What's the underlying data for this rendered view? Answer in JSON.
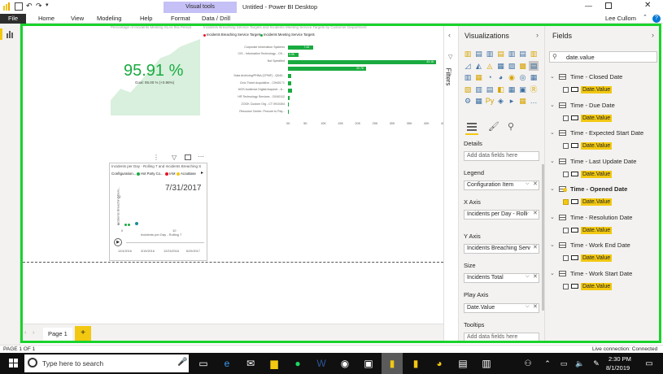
{
  "window": {
    "title": "Untitled - Power BI Desktop",
    "user": "Lee Cullom"
  },
  "ribbon": {
    "file": "File",
    "tabs": [
      "Home",
      "View",
      "Modeling",
      "Help",
      "Format",
      "Data / Drill"
    ],
    "contextual_group": "Visual tools"
  },
  "canvas": {
    "kpi_header": "Percentage of Incidents Meeting SLAs this Period",
    "kpi_value": "95.91 %",
    "kpi_goal": "Goal: 95.00 % (+0.96%)",
    "bar_header": "Incidents Breaching Service Targets and Incidents Meeting Service Targets by Customer Department",
    "bar_legend": [
      "Incidents Breaching Service Targets",
      "Incidents Meeting Service Targets"
    ],
    "scatter_title": "Incidents per Day - Rolling 7 and Incidents Breaching Service...",
    "scatter_legend_label": "Configuration...",
    "scatter_legend_items": [
      "Hot Party Co...",
      "IAM",
      "AccuBase"
    ],
    "scatter_date": "7/31/2017",
    "scatter_ylabel": "Incidents Breaching Serv...",
    "scatter_xlabel": "Incidents per Day - Rolling 7",
    "scatter_xticks": [
      "0",
      "10"
    ],
    "scatter_yticks": [
      "20",
      "0"
    ],
    "play_axis_ticks": [
      "12/4/2016",
      "3/19/2016",
      "12/23/2016",
      "6/29/2017"
    ]
  },
  "chart_data": {
    "type": "bar",
    "categories": [
      "Corporate Information Systems",
      "CIS - Information Technology - CK...",
      "Not Specified",
      "",
      "Data Archiving/PHNA (CPMF) - Q040...",
      "Civic Ticket Acquisition - CI940078",
      "NOS Audience Digital Acquisit... A...",
      "HR Technology Services - CI040112",
      "ZOOK Custom Org - CT 0910404",
      "Resource Center: Procure to Pay..."
    ],
    "series": [
      {
        "name": "Incidents Breaching Service Targets",
        "values": [
          1,
          0,
          2,
          1,
          0,
          0,
          0,
          0,
          0,
          0
        ]
      },
      {
        "name": "Incidents Meeting Service Targets",
        "values": [
          7.44,
          3.06,
          43.16,
          22.76,
          0.82,
          0.84,
          1.2,
          0.5,
          0.3,
          0.3
        ]
      }
    ],
    "bar_labels": [
      "7.44",
      "3.06",
      "43.16",
      "22.76",
      "",
      "0.84",
      "",
      "",
      "",
      ""
    ],
    "xticks": [
      "0K",
      "5K",
      "10K",
      "15K",
      "20K",
      "25K",
      "30K",
      "35K",
      "40K",
      "45K"
    ],
    "xlim": [
      0,
      45
    ]
  },
  "kpi_trend": [
    0.2,
    0.35,
    0.3,
    0.45,
    0.6,
    0.75,
    0.8,
    0.9,
    0.95,
    1.0
  ],
  "visualizations": {
    "header": "Visualizations",
    "sections": {
      "details": "Details",
      "details_placeholder": "Add data fields here",
      "legend": "Legend",
      "legend_value": "Configuration Item",
      "xaxis": "X Axis",
      "xaxis_value": "Incidents per Day - Rolli",
      "yaxis": "Y Axis",
      "yaxis_value": "Incidents Breaching Serv",
      "size": "Size",
      "size_value": "Incidents Total",
      "play_axis": "Play Axis",
      "play_axis_value": "Date.Value",
      "tooltips": "Tooltips",
      "tooltips_placeholder": "Add data fields here"
    }
  },
  "filters": {
    "label": "Filters"
  },
  "fields": {
    "header": "Fields",
    "search_value": "date.value",
    "tables": [
      {
        "name": "Time - Closed Date",
        "field": "Date.Value",
        "checked": false
      },
      {
        "name": "Time - Due Date",
        "field": "Date.Value",
        "checked": false
      },
      {
        "name": "Time - Expected Start Date",
        "field": "Date.Value",
        "checked": false
      },
      {
        "name": "Time - Last Update Date",
        "field": "Date.Value",
        "checked": false
      },
      {
        "name": "Time - Opened Date",
        "field": "Date.Value",
        "checked": true
      },
      {
        "name": "Time - Resolution Date",
        "field": "Date.Value",
        "checked": false
      },
      {
        "name": "Time - Work End Date",
        "field": "Date.Value",
        "checked": false
      },
      {
        "name": "Time - Work Start Date",
        "field": "Date.Value",
        "checked": false
      }
    ]
  },
  "pages": {
    "tab": "Page 1",
    "add": "+"
  },
  "status": {
    "page": "PAGE 1 OF 1",
    "connection": "Live connection: Connected"
  },
  "taskbar": {
    "search_placeholder": "Type here to search",
    "time": "2:30 PM",
    "date": "8/1/2019"
  },
  "colors": {
    "accent_green": "#19d32c",
    "bar_green": "#1aab40",
    "highlight": "#f2c811",
    "contextual": "#c5c0f5"
  }
}
